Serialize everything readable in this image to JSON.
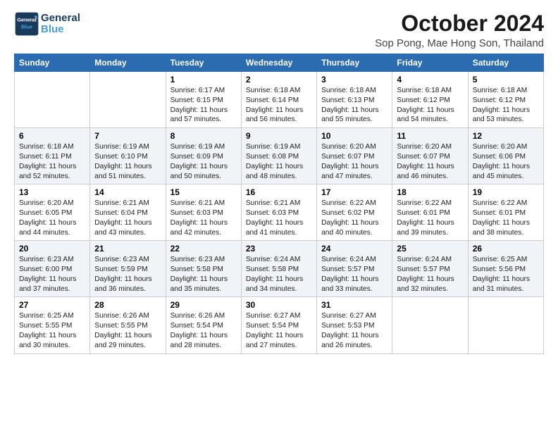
{
  "logo": {
    "line1": "General",
    "line2": "Blue"
  },
  "title": "October 2024",
  "subtitle": "Sop Pong, Mae Hong Son, Thailand",
  "header": {
    "accent_color": "#2b6cb0"
  },
  "weekdays": [
    "Sunday",
    "Monday",
    "Tuesday",
    "Wednesday",
    "Thursday",
    "Friday",
    "Saturday"
  ],
  "weeks": [
    [
      {
        "day": "",
        "detail": ""
      },
      {
        "day": "",
        "detail": ""
      },
      {
        "day": "1",
        "detail": "Sunrise: 6:17 AM\nSunset: 6:15 PM\nDaylight: 11 hours and 57 minutes."
      },
      {
        "day": "2",
        "detail": "Sunrise: 6:18 AM\nSunset: 6:14 PM\nDaylight: 11 hours and 56 minutes."
      },
      {
        "day": "3",
        "detail": "Sunrise: 6:18 AM\nSunset: 6:13 PM\nDaylight: 11 hours and 55 minutes."
      },
      {
        "day": "4",
        "detail": "Sunrise: 6:18 AM\nSunset: 6:12 PM\nDaylight: 11 hours and 54 minutes."
      },
      {
        "day": "5",
        "detail": "Sunrise: 6:18 AM\nSunset: 6:12 PM\nDaylight: 11 hours and 53 minutes."
      }
    ],
    [
      {
        "day": "6",
        "detail": "Sunrise: 6:18 AM\nSunset: 6:11 PM\nDaylight: 11 hours and 52 minutes."
      },
      {
        "day": "7",
        "detail": "Sunrise: 6:19 AM\nSunset: 6:10 PM\nDaylight: 11 hours and 51 minutes."
      },
      {
        "day": "8",
        "detail": "Sunrise: 6:19 AM\nSunset: 6:09 PM\nDaylight: 11 hours and 50 minutes."
      },
      {
        "day": "9",
        "detail": "Sunrise: 6:19 AM\nSunset: 6:08 PM\nDaylight: 11 hours and 48 minutes."
      },
      {
        "day": "10",
        "detail": "Sunrise: 6:20 AM\nSunset: 6:07 PM\nDaylight: 11 hours and 47 minutes."
      },
      {
        "day": "11",
        "detail": "Sunrise: 6:20 AM\nSunset: 6:07 PM\nDaylight: 11 hours and 46 minutes."
      },
      {
        "day": "12",
        "detail": "Sunrise: 6:20 AM\nSunset: 6:06 PM\nDaylight: 11 hours and 45 minutes."
      }
    ],
    [
      {
        "day": "13",
        "detail": "Sunrise: 6:20 AM\nSunset: 6:05 PM\nDaylight: 11 hours and 44 minutes."
      },
      {
        "day": "14",
        "detail": "Sunrise: 6:21 AM\nSunset: 6:04 PM\nDaylight: 11 hours and 43 minutes."
      },
      {
        "day": "15",
        "detail": "Sunrise: 6:21 AM\nSunset: 6:03 PM\nDaylight: 11 hours and 42 minutes."
      },
      {
        "day": "16",
        "detail": "Sunrise: 6:21 AM\nSunset: 6:03 PM\nDaylight: 11 hours and 41 minutes."
      },
      {
        "day": "17",
        "detail": "Sunrise: 6:22 AM\nSunset: 6:02 PM\nDaylight: 11 hours and 40 minutes."
      },
      {
        "day": "18",
        "detail": "Sunrise: 6:22 AM\nSunset: 6:01 PM\nDaylight: 11 hours and 39 minutes."
      },
      {
        "day": "19",
        "detail": "Sunrise: 6:22 AM\nSunset: 6:01 PM\nDaylight: 11 hours and 38 minutes."
      }
    ],
    [
      {
        "day": "20",
        "detail": "Sunrise: 6:23 AM\nSunset: 6:00 PM\nDaylight: 11 hours and 37 minutes."
      },
      {
        "day": "21",
        "detail": "Sunrise: 6:23 AM\nSunset: 5:59 PM\nDaylight: 11 hours and 36 minutes."
      },
      {
        "day": "22",
        "detail": "Sunrise: 6:23 AM\nSunset: 5:58 PM\nDaylight: 11 hours and 35 minutes."
      },
      {
        "day": "23",
        "detail": "Sunrise: 6:24 AM\nSunset: 5:58 PM\nDaylight: 11 hours and 34 minutes."
      },
      {
        "day": "24",
        "detail": "Sunrise: 6:24 AM\nSunset: 5:57 PM\nDaylight: 11 hours and 33 minutes."
      },
      {
        "day": "25",
        "detail": "Sunrise: 6:24 AM\nSunset: 5:57 PM\nDaylight: 11 hours and 32 minutes."
      },
      {
        "day": "26",
        "detail": "Sunrise: 6:25 AM\nSunset: 5:56 PM\nDaylight: 11 hours and 31 minutes."
      }
    ],
    [
      {
        "day": "27",
        "detail": "Sunrise: 6:25 AM\nSunset: 5:55 PM\nDaylight: 11 hours and 30 minutes."
      },
      {
        "day": "28",
        "detail": "Sunrise: 6:26 AM\nSunset: 5:55 PM\nDaylight: 11 hours and 29 minutes."
      },
      {
        "day": "29",
        "detail": "Sunrise: 6:26 AM\nSunset: 5:54 PM\nDaylight: 11 hours and 28 minutes."
      },
      {
        "day": "30",
        "detail": "Sunrise: 6:27 AM\nSunset: 5:54 PM\nDaylight: 11 hours and 27 minutes."
      },
      {
        "day": "31",
        "detail": "Sunrise: 6:27 AM\nSunset: 5:53 PM\nDaylight: 11 hours and 26 minutes."
      },
      {
        "day": "",
        "detail": ""
      },
      {
        "day": "",
        "detail": ""
      }
    ]
  ]
}
